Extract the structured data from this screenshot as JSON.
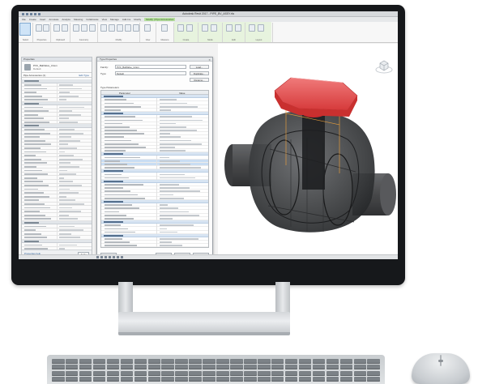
{
  "app": {
    "title": "Autodesk Revit 2017 - PIPE_BV_ASSY.rfa",
    "tabs": [
      "File",
      "Create",
      "Insert",
      "Annotate",
      "Analyze",
      "Massing",
      "Collaborate",
      "View",
      "Manage",
      "Add-Ins",
      "Modify"
    ],
    "context_tab": "Modify | Pipe Accessories"
  },
  "ribbon": {
    "groups": [
      "Select",
      "Properties",
      "Clipboard",
      "Geometry",
      "Modify",
      "View",
      "Measure",
      "Create",
      "Mode",
      "Edit",
      "Layout"
    ]
  },
  "properties": {
    "header": "Properties",
    "type_name": "PVC_BallValve_Union",
    "type_sub": "Default",
    "filter_label": "Pipe Accessories (1)",
    "edit_type": "Edit Type",
    "help": "Properties help",
    "apply": "Apply"
  },
  "type_dialog": {
    "title": "Type Properties",
    "family_label": "Family:",
    "family_value": "PVC_BallValve_Union",
    "type_label": "Type:",
    "type_value": "Default",
    "load_button": "Load...",
    "duplicate_button": "Duplicate...",
    "rename_button": "Rename...",
    "params_label": "Type Parameters",
    "col_parameter": "Parameter",
    "col_value": "Value",
    "preview_button": "<< Preview",
    "ok_button": "OK",
    "cancel_button": "Cancel",
    "apply_button": "Apply"
  },
  "colors": {
    "valve_handle": "#e8494a",
    "valve_body": "#3a3b3d",
    "accent": "#2f5f9a"
  }
}
